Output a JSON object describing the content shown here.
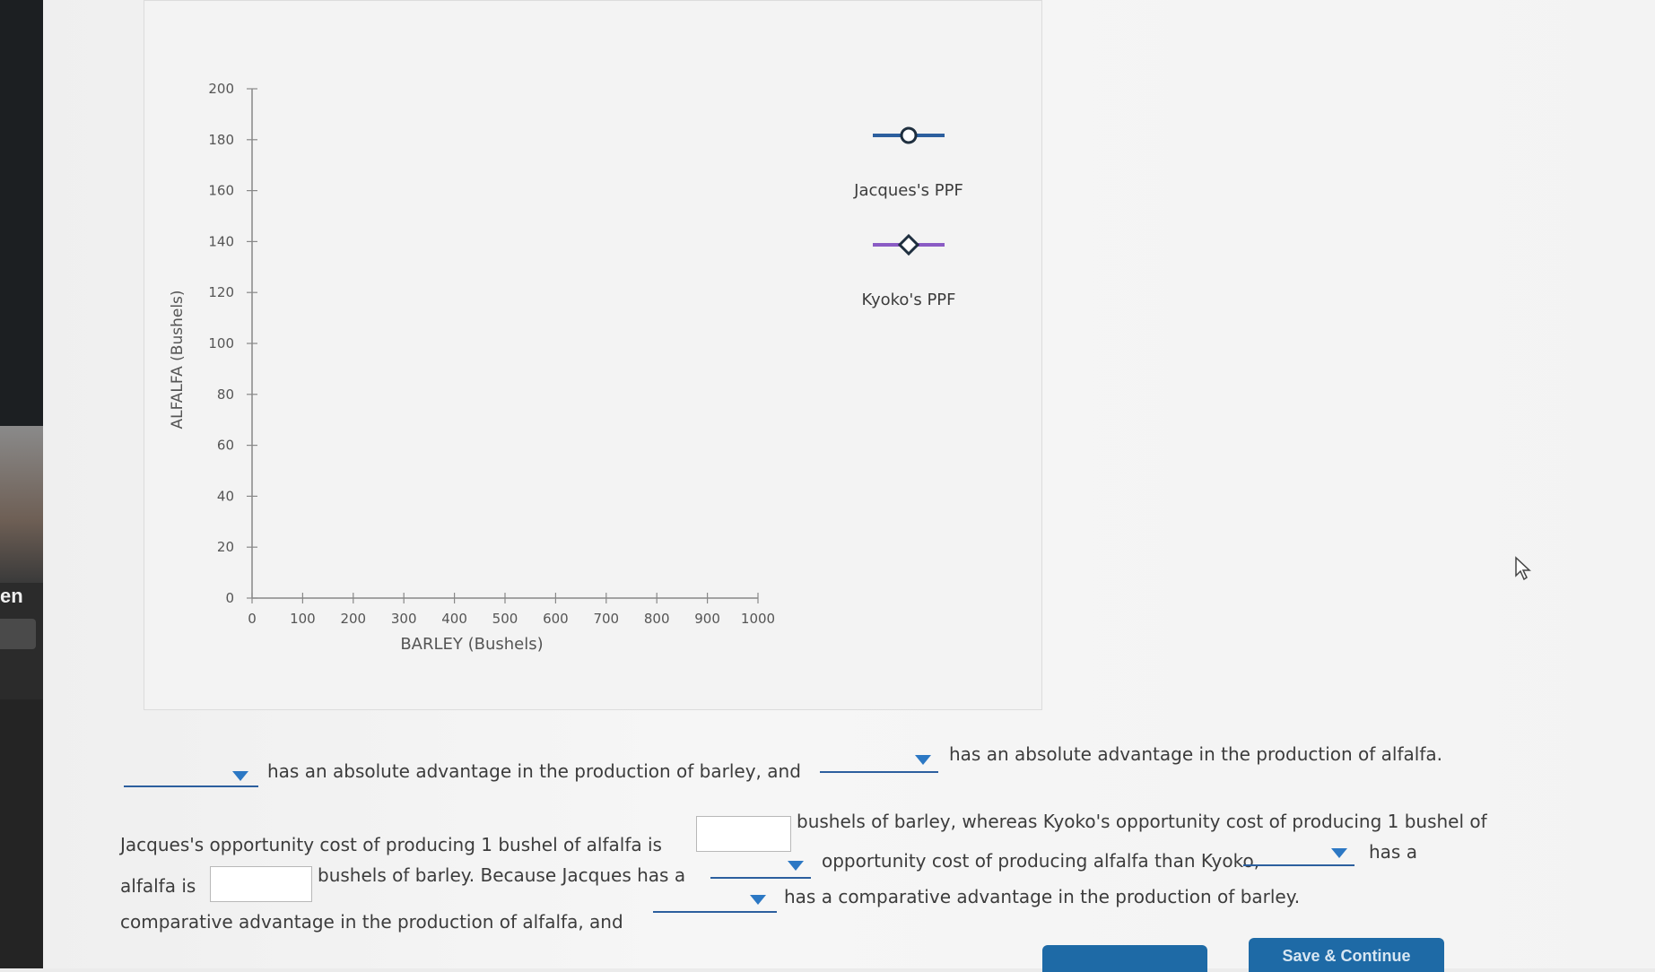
{
  "sidebar": {
    "tag_text": "en"
  },
  "chart_data": {
    "type": "line",
    "xlabel": "BARLEY (Bushels)",
    "ylabel": "ALFALFA (Bushels)",
    "xlim": [
      0,
      1000
    ],
    "ylim": [
      0,
      200
    ],
    "x_ticks": [
      "0",
      "100",
      "200",
      "300",
      "400",
      "500",
      "600",
      "700",
      "800",
      "900",
      "1000"
    ],
    "y_ticks": [
      "0",
      "20",
      "40",
      "60",
      "80",
      "100",
      "120",
      "140",
      "160",
      "180",
      "200"
    ],
    "series": [
      {
        "name": "Jacques's PPF",
        "color": "#2c5f9e",
        "marker": "circle",
        "points": []
      },
      {
        "name": "Kyoko's PPF",
        "color": "#8a5bc4",
        "marker": "diamond",
        "points": []
      }
    ],
    "legend_position": "right"
  },
  "question": {
    "sentence1": {
      "part1": "has an absolute advantage in the production of barley, and",
      "part2": "has an absolute advantage in the production of alfalfa."
    },
    "sentence2": {
      "part1": "Jacques's opportunity cost of producing 1 bushel of alfalfa is",
      "part2": "bushels of barley, whereas Kyoko's opportunity cost of producing 1 bushel of",
      "part3": "alfalfa is",
      "part4": "bushels of barley. Because Jacques has a",
      "part5": "opportunity cost of producing alfalfa than Kyoko,",
      "part6": "has a",
      "part7": "comparative advantage in the production of alfalfa, and",
      "part8": "has a comparative advantage in the production of barley."
    }
  },
  "buttons": {
    "left_label": "",
    "save_label": "Save & Continue"
  },
  "colors": {
    "accent": "#1e6aa6",
    "jacques": "#2c5f9e",
    "kyoko": "#8a5bc4"
  }
}
